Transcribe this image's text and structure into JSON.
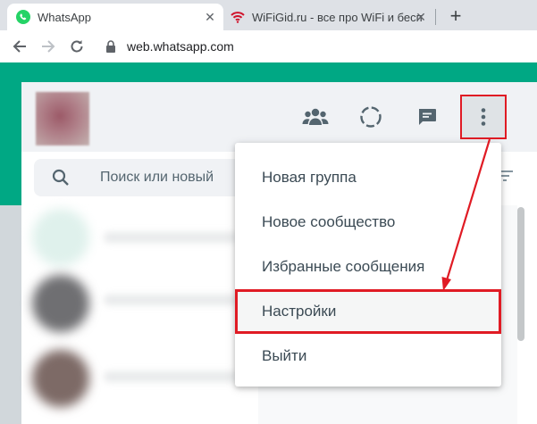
{
  "browser": {
    "tabs": [
      {
        "title": "WhatsApp",
        "favicon": "whatsapp-icon",
        "active": true
      },
      {
        "title": "WiFiGid.ru - все про WiFi и бесп",
        "favicon": "wifi-icon",
        "active": false
      }
    ],
    "address_bar": {
      "url": "web.whatsapp.com",
      "icon": "lock-icon"
    }
  },
  "header": {
    "icons": [
      "communities-icon",
      "status-icon",
      "new-chat-icon",
      "menu-icon"
    ]
  },
  "search": {
    "placeholder": "Поиск или новый"
  },
  "menu": {
    "items": [
      {
        "label": "Новая группа"
      },
      {
        "label": "Новое сообщество"
      },
      {
        "label": "Избранные сообщения"
      },
      {
        "label": "Настройки",
        "highlighted": true
      },
      {
        "label": "Выйти"
      }
    ]
  },
  "colors": {
    "brand_green": "#00a884",
    "annotation_red": "#e01b24",
    "header_bg": "#f0f2f5"
  }
}
